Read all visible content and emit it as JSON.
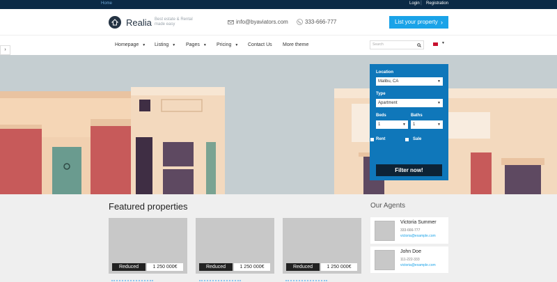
{
  "topbar": {
    "home": "Home",
    "login": "Login",
    "separator": "|",
    "registration": "Registration"
  },
  "header": {
    "brand": "Realia",
    "tagline": "Best estate & Rental made easy",
    "email": "info@byaviators.com",
    "phone": "333-666-777",
    "list_button": "List your property"
  },
  "nav": {
    "items": [
      {
        "label": "Homepage",
        "dropdown": true
      },
      {
        "label": "Listing",
        "dropdown": true
      },
      {
        "label": "Pages",
        "dropdown": true
      },
      {
        "label": "Pricing",
        "dropdown": true
      },
      {
        "label": "Contact Us",
        "dropdown": false
      },
      {
        "label": "More theme",
        "dropdown": false
      }
    ],
    "search_placeholder": "Search",
    "language_icon": "uk-flag-icon"
  },
  "filter": {
    "location_label": "Location",
    "location_value": "Malibu, CA",
    "type_label": "Type",
    "type_value": "Apartment",
    "beds_label": "Beds",
    "beds_value": "1",
    "baths_label": "Baths",
    "baths_value": "1",
    "rent_label": "Rent",
    "sale_label": "Sale",
    "submit": "Filter now!"
  },
  "featured": {
    "title": "Featured properties",
    "cards": [
      {
        "badge": "Reduced",
        "price": "1 250 000€"
      },
      {
        "badge": "Reduced",
        "price": "1 250 000€"
      },
      {
        "badge": "Reduced",
        "price": "1 250 000€"
      }
    ]
  },
  "agents": {
    "title": "Our Agents",
    "list": [
      {
        "name": "Victoria Summer",
        "phone": "333-666-777",
        "email": "victoria@example.com"
      },
      {
        "name": "John Doe",
        "phone": "111-222-333",
        "email": "victoria@example.com"
      }
    ]
  },
  "colors": {
    "accent": "#1aa3e8",
    "dark": "#0b2a46",
    "filter_bg": "#0f77ba",
    "button_dark": "#0d2336"
  }
}
